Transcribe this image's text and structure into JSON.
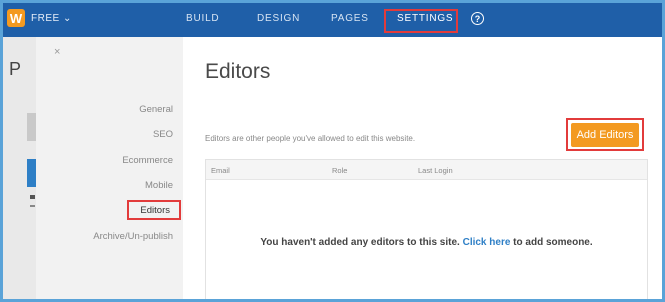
{
  "topbar": {
    "logo_letter": "W",
    "plan_label": "FREE ⌄",
    "nav": [
      "BUILD",
      "DESIGN",
      "PAGES",
      "SETTINGS"
    ],
    "help_glyph": "?"
  },
  "left_strip": {
    "letter": "P"
  },
  "sidemenu": {
    "close_glyph": "×",
    "items": [
      "General",
      "SEO",
      "Ecommerce",
      "Mobile",
      "Editors",
      "Archive/Un-publish"
    ],
    "active": "Editors"
  },
  "main": {
    "title": "Editors",
    "description": "Editors are other people you've allowed to edit this website.",
    "add_button": "Add Editors",
    "columns": [
      "Email",
      "Role",
      "Last Login"
    ],
    "empty_before": "You haven't added any editors to this site. ",
    "empty_link": "Click here",
    "empty_after": " to add someone."
  },
  "colors": {
    "topbar": "#1f5fa8",
    "accent_orange": "#f39a21",
    "highlight_red": "#e23b3b",
    "link_blue": "#2e7fc6"
  },
  "icons": [
    "weebly-logo-icon",
    "chevron-down-icon",
    "help-icon",
    "close-icon"
  ]
}
